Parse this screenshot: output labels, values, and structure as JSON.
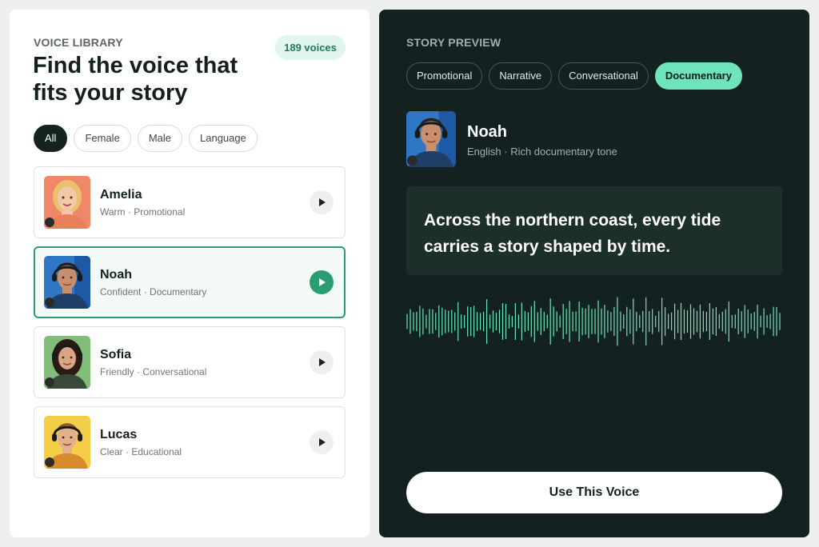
{
  "library": {
    "eyebrow": "VOICE LIBRARY",
    "title": "Find the voice that fits your story",
    "count_badge": "189 voices",
    "filters": [
      "All",
      "Female",
      "Male",
      "Language"
    ],
    "active_filter": "All",
    "voices": [
      {
        "name": "Amelia",
        "description": "Warm · Promotional",
        "selected": false
      },
      {
        "name": "Noah",
        "description": "Confident · Documentary",
        "selected": true
      },
      {
        "name": "Sofia",
        "description": "Friendly · Conversational",
        "selected": false
      },
      {
        "name": "Lucas",
        "description": "Clear · Educational",
        "selected": false
      }
    ]
  },
  "preview": {
    "eyebrow": "STORY PREVIEW",
    "tones": [
      "Promotional",
      "Narrative",
      "Conversational",
      "Documentary"
    ],
    "active_tone": "Documentary",
    "voice_name": "Noah",
    "voice_meta": "English · Rich documentary tone",
    "sample_text": "Across the northern coast, every tide carries a story shaped by time.",
    "use_button_label": "Use This Voice"
  },
  "icons": {
    "play": "play-icon",
    "waveform": "waveform-visual"
  },
  "colors": {
    "accent": "#2a9d72",
    "accent_light": "#6fe3bb",
    "dark_panel": "#132220"
  }
}
